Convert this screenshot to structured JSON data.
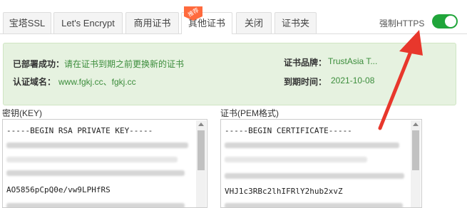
{
  "tabs": [
    {
      "label": "宝塔SSL",
      "active": false
    },
    {
      "label": "Let's Encrypt",
      "active": false
    },
    {
      "label": "商用证书",
      "active": false
    },
    {
      "label": "其他证书",
      "active": true
    },
    {
      "label": "关闭",
      "active": false
    },
    {
      "label": "证书夹",
      "active": false
    }
  ],
  "hot_badge": "推荐",
  "force_https": {
    "label": "强制HTTPS",
    "enabled": true
  },
  "info": {
    "deploy_label": "已部署成功：",
    "deploy_value": "请在证书到期之前更换新的证书",
    "brand_label": "证书品牌：",
    "brand_value": "TrustAsia T...",
    "domain_label": "认证域名：",
    "domain_value": "www.fgkj.cc、fgkj.cc",
    "expiry_label": "到期时间：",
    "expiry_value": "2021-10-08"
  },
  "key_pane": {
    "label": "密钥(KEY)",
    "lines": [
      "-----BEGIN RSA PRIVATE KEY-----",
      "AO5856pCpQ0e/vw9LPHfRS"
    ]
  },
  "cert_pane": {
    "label": "证书(PEM格式)",
    "lines": [
      "-----BEGIN CERTIFICATE-----",
      "VHJ1c3RBc2lhIFRlY2hub2xvZ"
    ]
  },
  "colors": {
    "accent": "#20a53a",
    "info_bg": "#e6f2e0",
    "annotation_arrow": "#e8372c",
    "badge": "#ff6a3d"
  }
}
